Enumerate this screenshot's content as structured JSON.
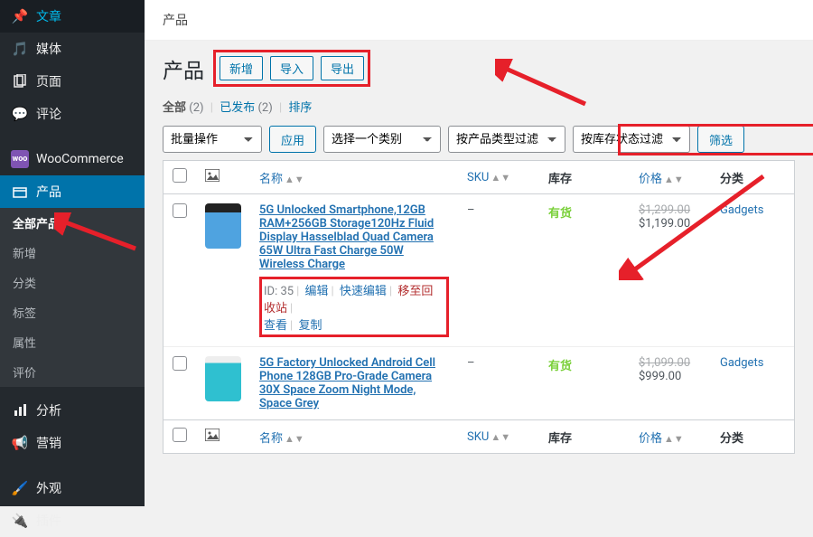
{
  "sidebar": {
    "items": [
      {
        "label": "文章",
        "icon": "pin"
      },
      {
        "label": "媒体",
        "icon": "media"
      },
      {
        "label": "页面",
        "icon": "page"
      },
      {
        "label": "评论",
        "icon": "comment"
      },
      {
        "label": "WooCommerce",
        "icon": "woo"
      },
      {
        "label": "产品",
        "icon": "product",
        "active": true,
        "submenu": [
          {
            "label": "全部产品",
            "active": true
          },
          {
            "label": "新增"
          },
          {
            "label": "分类"
          },
          {
            "label": "标签"
          },
          {
            "label": "属性"
          },
          {
            "label": "评价"
          }
        ]
      },
      {
        "label": "分析",
        "icon": "chart"
      },
      {
        "label": "营销",
        "icon": "megaphone"
      },
      {
        "label": "外观",
        "icon": "brush"
      },
      {
        "label": "插件",
        "icon": "plugin"
      }
    ]
  },
  "breadcrumb": "产品",
  "page_title": "产品",
  "buttons": {
    "add": "新增",
    "import": "导入",
    "export": "导出"
  },
  "subsub": {
    "all": "全部",
    "all_count": "(2)",
    "published": "已发布",
    "published_count": "(2)",
    "sort": "排序"
  },
  "bulk": {
    "label": "批量操作",
    "apply": "应用"
  },
  "filters": {
    "category": "选择一个类别",
    "by_type": "按产品类型过滤",
    "by_stock": "按库存状态过滤",
    "button": "筛选"
  },
  "columns": {
    "name": "名称",
    "sku": "SKU",
    "stock": "库存",
    "price": "价格",
    "cat": "分类"
  },
  "rows": [
    {
      "name": "5G Unlocked Smartphone,12GB RAM+256GB Storage120Hz Fluid Display Hasselblad Quad Camera 65W Ultra Fast Charge 50W Wireless Charge",
      "sku": "–",
      "stock": "有货",
      "price_old": "$1,299.00",
      "price_new": "$1,199.00",
      "cat": "Gadgets",
      "actions": {
        "id": "ID: 35",
        "edit": "编辑",
        "quick": "快速编辑",
        "trash": "移至回收站",
        "view": "查看",
        "dup": "复制"
      }
    },
    {
      "name": "5G Factory Unlocked Android Cell Phone 128GB Pro-Grade Camera 30X Space Zoom Night Mode, Space Grey",
      "sku": "–",
      "stock": "有货",
      "price_old": "$1,099.00",
      "price_new": "$999.00",
      "cat": "Gadgets"
    }
  ]
}
